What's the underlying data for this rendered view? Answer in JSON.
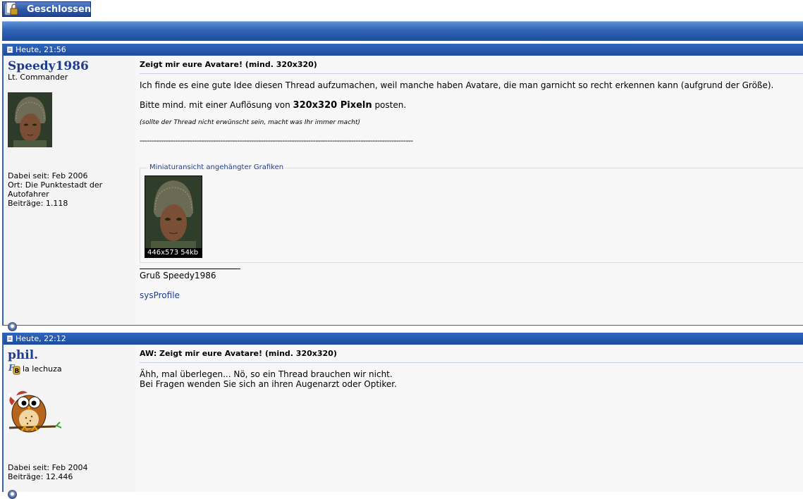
{
  "toolbar": {
    "closed_label": "Geschlossen"
  },
  "posts": [
    {
      "time": "Heute, 21:56",
      "username": "Speedy1986",
      "usertitle": "Lt. Commander",
      "stats": [
        "Dabei seit: Feb 2006",
        "Ort: Die Punktestadt der",
        "Autofahrer",
        "Beiträge: 1.118"
      ],
      "subject": "Zeigt mir eure Avatare! (mind. 320x320)",
      "line1": "Ich finde es eine gute Idee diesen Thread aufzumachen, weil manche haben Avatare, die man garnicht so recht erkennen kann (aufgrund der Größe).",
      "line2_pre": "Bitte mind. mit einer Auflösung von ",
      "line2_bold": "320x320 Pixeln",
      "line2_post": " posten.",
      "small_note": "(sollte der Thread nicht erwünscht sein, macht was Ihr immer macht)",
      "dashes": "-------------------------------------------------------------------------------------------------------------------",
      "attach_legend": "Miniaturansicht angehängter Grafiken",
      "thumb_caption": "446x573  54kb",
      "signature": "Gruß Speedy1986",
      "sig_link": "sysProfile"
    },
    {
      "time": "Heute, 22:12",
      "username": "phil.",
      "usertitle": "la lechuza",
      "stats": [
        "Dabei seit: Feb 2004",
        "Beiträge: 12.446"
      ],
      "subject": "AW: Zeigt mir eure Avatare! (mind. 320x320)",
      "line1": "Ähh, mal überlegen... Nö, so ein Thread brauchen wir nicht.",
      "line2": "Bei Fragen wenden Sie sich an ihren Augenarzt oder Optiker."
    }
  ],
  "colors": {
    "header_blue": "#2f63b4",
    "username_blue": "#1f3c8f"
  }
}
